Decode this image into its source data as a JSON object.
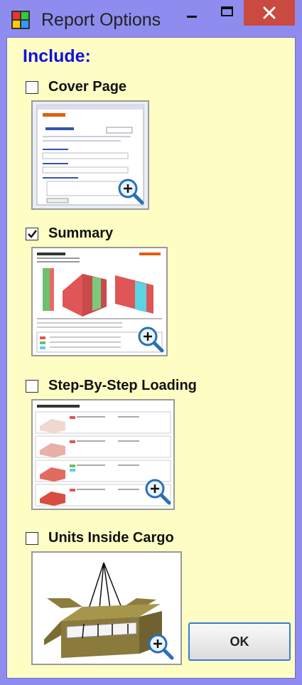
{
  "window": {
    "title": "Report Options"
  },
  "include_label": "Include:",
  "options": [
    {
      "label": "Cover Page",
      "checked": false
    },
    {
      "label": "Summary",
      "checked": true
    },
    {
      "label": "Step-By-Step Loading",
      "checked": false
    },
    {
      "label": "Units Inside Cargo",
      "checked": false
    }
  ],
  "ok_label": "OK",
  "colors": {
    "client_bg": "#fdfdc4",
    "titlebar_bg": "#8f8cf0",
    "close_bg": "#c94a3f",
    "include_text": "#1010e0",
    "ok_border": "#3a7bd5"
  },
  "icons": [
    "app-icon",
    "minimize-icon",
    "maximize-icon",
    "close-icon",
    "zoom-icon",
    "check-icon"
  ]
}
